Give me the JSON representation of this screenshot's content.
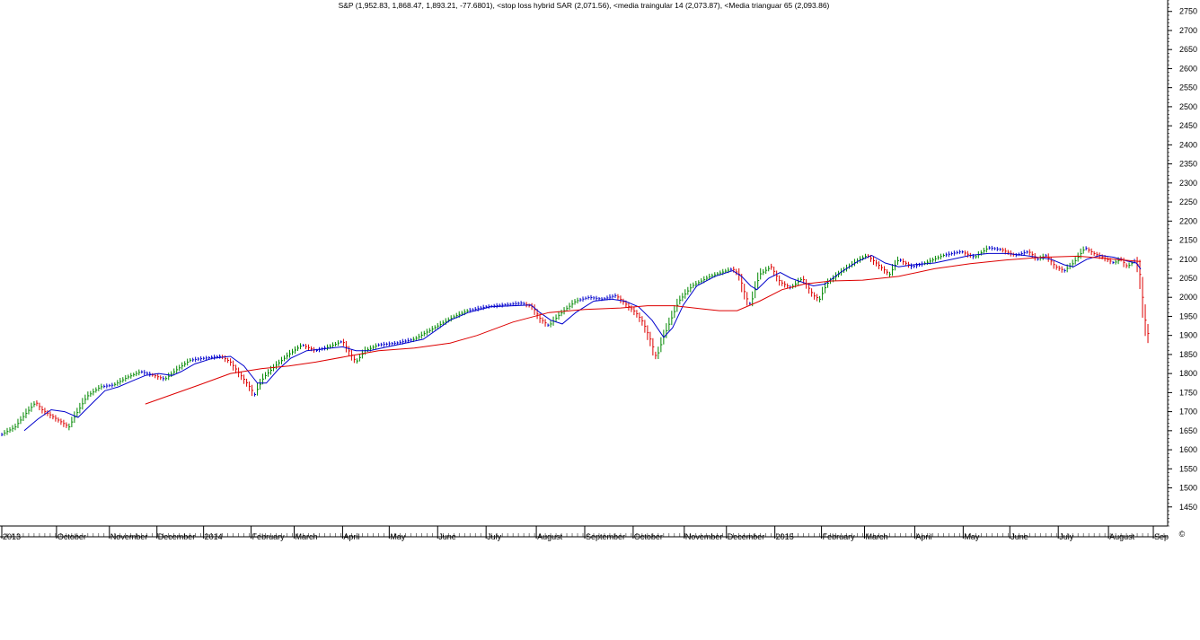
{
  "chart_data": {
    "type": "line",
    "title": "S&P (1,952.83, 1,868.47, 1,893.21, -77.6801), <stop loss hybrid SAR (2,071.56), <media traingular 14 (2,073.87), <Media trianguar 65 (2,093.86)",
    "ylim": [
      1400,
      2780
    ],
    "y_ticks": [
      1450,
      1500,
      1550,
      1600,
      1650,
      1700,
      1750,
      1800,
      1850,
      1900,
      1950,
      2000,
      2050,
      2100,
      2150,
      2200,
      2250,
      2300,
      2350,
      2400,
      2450,
      2500,
      2550,
      2600,
      2650,
      2700,
      2750
    ],
    "x_labels": [
      {
        "label": "2013",
        "t": 0
      },
      {
        "label": "October",
        "t": 61
      },
      {
        "label": "November",
        "t": 120
      },
      {
        "label": "December",
        "t": 173
      },
      {
        "label": "2014",
        "t": 225
      },
      {
        "label": "February",
        "t": 278
      },
      {
        "label": "March",
        "t": 326
      },
      {
        "label": "April",
        "t": 380
      },
      {
        "label": "May",
        "t": 432
      },
      {
        "label": "June",
        "t": 486
      },
      {
        "label": "July",
        "t": 540
      },
      {
        "label": "August",
        "t": 596
      },
      {
        "label": "September",
        "t": 650
      },
      {
        "label": "October",
        "t": 704
      },
      {
        "label": "November",
        "t": 761
      },
      {
        "label": "December",
        "t": 808
      },
      {
        "label": "2015",
        "t": 862
      },
      {
        "label": "February",
        "t": 914
      },
      {
        "label": "March",
        "t": 962
      },
      {
        "label": "April",
        "t": 1018
      },
      {
        "label": "May",
        "t": 1072
      },
      {
        "label": "June",
        "t": 1124
      },
      {
        "label": "July",
        "t": 1178
      },
      {
        "label": "August",
        "t": 1234
      },
      {
        "label": "Sep",
        "t": 1284
      }
    ],
    "x_range": [
      0,
      1300
    ],
    "price_anchors": [
      [
        0,
        1640
      ],
      [
        15,
        1660
      ],
      [
        25,
        1690
      ],
      [
        38,
        1725
      ],
      [
        45,
        1705
      ],
      [
        55,
        1690
      ],
      [
        65,
        1675
      ],
      [
        75,
        1660
      ],
      [
        82,
        1690
      ],
      [
        95,
        1740
      ],
      [
        110,
        1765
      ],
      [
        125,
        1770
      ],
      [
        140,
        1790
      ],
      [
        155,
        1805
      ],
      [
        170,
        1795
      ],
      [
        182,
        1785
      ],
      [
        195,
        1810
      ],
      [
        210,
        1835
      ],
      [
        225,
        1840
      ],
      [
        245,
        1845
      ],
      [
        255,
        1830
      ],
      [
        265,
        1800
      ],
      [
        275,
        1770
      ],
      [
        282,
        1745
      ],
      [
        292,
        1790
      ],
      [
        305,
        1820
      ],
      [
        320,
        1850
      ],
      [
        335,
        1875
      ],
      [
        350,
        1860
      ],
      [
        365,
        1870
      ],
      [
        380,
        1885
      ],
      [
        395,
        1830
      ],
      [
        405,
        1860
      ],
      [
        420,
        1875
      ],
      [
        440,
        1880
      ],
      [
        460,
        1890
      ],
      [
        475,
        1910
      ],
      [
        490,
        1930
      ],
      [
        505,
        1950
      ],
      [
        520,
        1965
      ],
      [
        540,
        1975
      ],
      [
        560,
        1980
      ],
      [
        580,
        1985
      ],
      [
        592,
        1975
      ],
      [
        600,
        1945
      ],
      [
        610,
        1925
      ],
      [
        622,
        1955
      ],
      [
        640,
        1990
      ],
      [
        655,
        2000
      ],
      [
        670,
        1995
      ],
      [
        685,
        2005
      ],
      [
        697,
        1980
      ],
      [
        707,
        1960
      ],
      [
        715,
        1935
      ],
      [
        724,
        1885
      ],
      [
        730,
        1840
      ],
      [
        737,
        1890
      ],
      [
        745,
        1935
      ],
      [
        755,
        1990
      ],
      [
        770,
        2030
      ],
      [
        790,
        2055
      ],
      [
        815,
        2075
      ],
      [
        822,
        2060
      ],
      [
        830,
        2000
      ],
      [
        835,
        1980
      ],
      [
        845,
        2060
      ],
      [
        858,
        2080
      ],
      [
        868,
        2040
      ],
      [
        880,
        2025
      ],
      [
        893,
        2050
      ],
      [
        905,
        2005
      ],
      [
        912,
        1995
      ],
      [
        920,
        2035
      ],
      [
        935,
        2065
      ],
      [
        950,
        2090
      ],
      [
        965,
        2110
      ],
      [
        980,
        2080
      ],
      [
        990,
        2060
      ],
      [
        1000,
        2100
      ],
      [
        1015,
        2080
      ],
      [
        1030,
        2090
      ],
      [
        1050,
        2110
      ],
      [
        1070,
        2120
      ],
      [
        1085,
        2105
      ],
      [
        1100,
        2130
      ],
      [
        1115,
        2125
      ],
      [
        1130,
        2110
      ],
      [
        1145,
        2120
      ],
      [
        1155,
        2100
      ],
      [
        1165,
        2110
      ],
      [
        1175,
        2080
      ],
      [
        1185,
        2070
      ],
      [
        1195,
        2090
      ],
      [
        1208,
        2130
      ],
      [
        1218,
        2115
      ],
      [
        1228,
        2105
      ],
      [
        1240,
        2090
      ],
      [
        1248,
        2100
      ],
      [
        1255,
        2080
      ],
      [
        1263,
        2095
      ],
      [
        1268,
        2080
      ],
      [
        1272,
        2000
      ],
      [
        1276,
        1920
      ],
      [
        1280,
        1890
      ]
    ],
    "series": [
      {
        "name": "media traingular 14",
        "color": "#0000cc",
        "last_value": 2073.87,
        "points": [
          [
            25,
            1650
          ],
          [
            40,
            1680
          ],
          [
            55,
            1705
          ],
          [
            70,
            1700
          ],
          [
            85,
            1685
          ],
          [
            100,
            1720
          ],
          [
            115,
            1755
          ],
          [
            130,
            1765
          ],
          [
            145,
            1780
          ],
          [
            160,
            1795
          ],
          [
            175,
            1800
          ],
          [
            190,
            1795
          ],
          [
            200,
            1805
          ],
          [
            215,
            1825
          ],
          [
            235,
            1840
          ],
          [
            255,
            1845
          ],
          [
            270,
            1820
          ],
          [
            285,
            1775
          ],
          [
            295,
            1775
          ],
          [
            308,
            1810
          ],
          [
            322,
            1840
          ],
          [
            340,
            1860
          ],
          [
            360,
            1865
          ],
          [
            380,
            1870
          ],
          [
            395,
            1860
          ],
          [
            410,
            1860
          ],
          [
            430,
            1870
          ],
          [
            450,
            1880
          ],
          [
            470,
            1890
          ],
          [
            485,
            1915
          ],
          [
            500,
            1940
          ],
          [
            520,
            1960
          ],
          [
            545,
            1975
          ],
          [
            570,
            1978
          ],
          [
            590,
            1980
          ],
          [
            600,
            1960
          ],
          [
            612,
            1940
          ],
          [
            625,
            1930
          ],
          [
            640,
            1960
          ],
          [
            660,
            1990
          ],
          [
            680,
            1995
          ],
          [
            695,
            1990
          ],
          [
            710,
            1975
          ],
          [
            725,
            1940
          ],
          [
            738,
            1895
          ],
          [
            748,
            1920
          ],
          [
            760,
            1980
          ],
          [
            775,
            2030
          ],
          [
            795,
            2055
          ],
          [
            815,
            2070
          ],
          [
            825,
            2055
          ],
          [
            835,
            2030
          ],
          [
            842,
            2020
          ],
          [
            855,
            2050
          ],
          [
            868,
            2065
          ],
          [
            880,
            2050
          ],
          [
            892,
            2040
          ],
          [
            905,
            2030
          ],
          [
            918,
            2035
          ],
          [
            935,
            2065
          ],
          [
            955,
            2095
          ],
          [
            970,
            2110
          ],
          [
            985,
            2090
          ],
          [
            1000,
            2080
          ],
          [
            1015,
            2085
          ],
          [
            1040,
            2090
          ],
          [
            1060,
            2100
          ],
          [
            1080,
            2110
          ],
          [
            1100,
            2115
          ],
          [
            1120,
            2115
          ],
          [
            1140,
            2110
          ],
          [
            1155,
            2105
          ],
          [
            1170,
            2100
          ],
          [
            1185,
            2085
          ],
          [
            1195,
            2080
          ],
          [
            1210,
            2100
          ],
          [
            1225,
            2110
          ],
          [
            1240,
            2105
          ],
          [
            1255,
            2095
          ],
          [
            1265,
            2090
          ],
          [
            1270,
            2073.87
          ]
        ]
      },
      {
        "name": "Media trianguar 65",
        "color": "#dd0000",
        "last_value": 2093.86,
        "points": [
          [
            160,
            1720
          ],
          [
            190,
            1745
          ],
          [
            220,
            1770
          ],
          [
            255,
            1800
          ],
          [
            290,
            1813
          ],
          [
            320,
            1820
          ],
          [
            350,
            1830
          ],
          [
            385,
            1845
          ],
          [
            420,
            1860
          ],
          [
            460,
            1867
          ],
          [
            500,
            1880
          ],
          [
            530,
            1900
          ],
          [
            570,
            1935
          ],
          [
            610,
            1960
          ],
          [
            650,
            1968
          ],
          [
            690,
            1972
          ],
          [
            720,
            1978
          ],
          [
            750,
            1978
          ],
          [
            780,
            1970
          ],
          [
            800,
            1965
          ],
          [
            820,
            1965
          ],
          [
            845,
            1990
          ],
          [
            870,
            2020
          ],
          [
            895,
            2035
          ],
          [
            925,
            2043
          ],
          [
            960,
            2045
          ],
          [
            1000,
            2055
          ],
          [
            1040,
            2075
          ],
          [
            1080,
            2088
          ],
          [
            1120,
            2098
          ],
          [
            1160,
            2105
          ],
          [
            1200,
            2108
          ],
          [
            1240,
            2100
          ],
          [
            1270,
            2093.86
          ]
        ]
      }
    ],
    "stop_loss_hybrid_sar": {
      "name": "stop loss hybrid SAR",
      "last_value": 2071.56
    },
    "colors": {
      "up": "#008800",
      "down": "#dd0000",
      "neutral": "#0000cc",
      "axis": "#000000",
      "background": "#ffffff"
    },
    "grid": false,
    "legend": "none"
  },
  "corner_symbol": "©"
}
